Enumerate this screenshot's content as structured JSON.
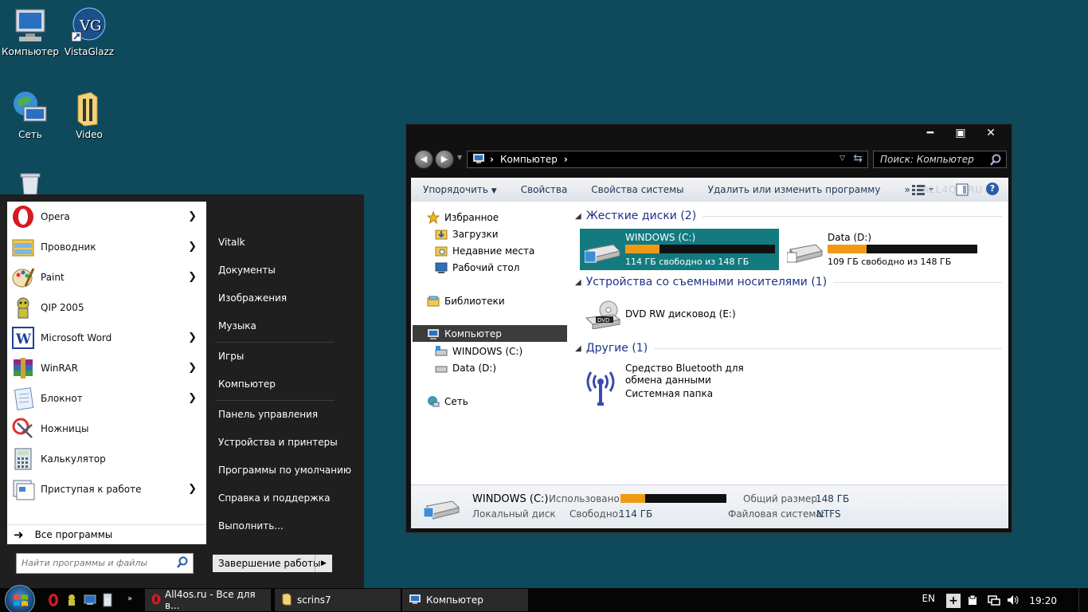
{
  "desktop": {
    "icons": [
      {
        "label": "Компьютер"
      },
      {
        "label": "VistaGlazz"
      },
      {
        "label": "Сеть"
      },
      {
        "label": "Video"
      }
    ]
  },
  "start_menu": {
    "programs": [
      {
        "label": "Opera",
        "icon": "opera-icon",
        "submenu": true
      },
      {
        "label": "Проводник",
        "icon": "explorer-icon",
        "submenu": true
      },
      {
        "label": "Paint",
        "icon": "paint-icon",
        "submenu": true
      },
      {
        "label": "QIP 2005",
        "icon": "qip-icon",
        "submenu": false
      },
      {
        "label": "Microsoft Word",
        "icon": "word-icon",
        "submenu": true
      },
      {
        "label": "WinRAR",
        "icon": "winrar-icon",
        "submenu": true
      },
      {
        "label": "Блокнот",
        "icon": "notepad-icon",
        "submenu": true
      },
      {
        "label": "Ножницы",
        "icon": "scissors-icon",
        "submenu": false
      },
      {
        "label": "Калькулятор",
        "icon": "calculator-icon",
        "submenu": false
      },
      {
        "label": "Приступая к работе",
        "icon": "getting-started-icon",
        "submenu": true
      }
    ],
    "all_programs": "Все программы",
    "search_placeholder": "Найти программы и файлы",
    "right_items": [
      "Vitalk",
      "Документы",
      "Изображения",
      "Музыка",
      "Игры",
      "Компьютер",
      "Панель управления",
      "Устройства и принтеры",
      "Программы по умолчанию",
      "Справка и поддержка",
      "Выполнить..."
    ],
    "shutdown": "Завершение работы"
  },
  "explorer": {
    "address": {
      "segment": "Компьютер"
    },
    "search_placeholder": "Поиск: Компьютер",
    "toolbar": [
      "Упорядочить",
      "Свойства",
      "Свойства системы",
      "Удалить или изменить программу"
    ],
    "toolbar_more": "»",
    "watermark": "ALL4OS.RU",
    "nav": {
      "favorites": "Избранное",
      "downloads": "Загрузки",
      "recent": "Недавние места",
      "desktop": "Рабочий стол",
      "libraries": "Библиотеки",
      "computer": "Компьютер",
      "drive_c": "WINDOWS (C:)",
      "drive_d": "Data (D:)",
      "network": "Сеть"
    },
    "groups": {
      "hard_drives": "Жесткие диски (2)",
      "removable": "Устройства со съемными носителями (1)",
      "other": "Другие (1)"
    },
    "drives": [
      {
        "name": "WINDOWS (C:)",
        "free": "114 ГБ свободно из 148 ГБ",
        "used_fraction": 0.23
      },
      {
        "name": "Data (D:)",
        "free": "109 ГБ свободно из 148 ГБ",
        "used_fraction": 0.26
      }
    ],
    "dvd": "DVD RW дисковод (E:)",
    "bluetooth": {
      "name": "Средство Bluetooth для обмена данными",
      "type": "Системная папка"
    },
    "details": {
      "name": "WINDOWS (C:)",
      "type": "Локальный диск",
      "used_label": "Использовано:",
      "used_fraction": 0.23,
      "free_label": "Свободно:",
      "free_value": "114 ГБ",
      "total_label": "Общий размер:",
      "total_value": "148 ГБ",
      "fs_label": "Файловая система:",
      "fs_value": "NTFS"
    }
  },
  "taskbar": {
    "tasks": [
      {
        "label": "All4os.ru - Все для в..."
      },
      {
        "label": "scrins7"
      },
      {
        "label": "Компьютер"
      }
    ],
    "language": "EN",
    "clock": "19:20"
  },
  "colors": {
    "desktop_bg": "#0e4a5c",
    "selection": "#137b80",
    "bar_fill": "#f09a14"
  }
}
